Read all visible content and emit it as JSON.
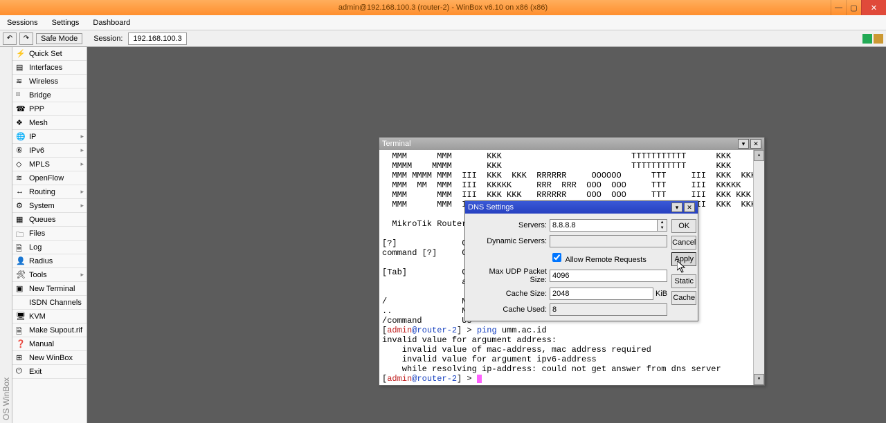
{
  "title": "admin@192.168.100.3 (router-2) - WinBox v6.10 on x86 (x86)",
  "menu": {
    "sessions": "Sessions",
    "settings": "Settings",
    "dashboard": "Dashboard"
  },
  "toolbar": {
    "back": "↶",
    "fwd": "↷",
    "safe_mode": "Safe Mode",
    "session_label": "Session:",
    "session_value": "192.168.100.3"
  },
  "sidebar_vert": "OS WinBox",
  "sidebar": [
    {
      "label": "Quick Set",
      "icon": "⚡",
      "arrow": false
    },
    {
      "label": "Interfaces",
      "icon": "▤",
      "arrow": false
    },
    {
      "label": "Wireless",
      "icon": "≋",
      "arrow": false
    },
    {
      "label": "Bridge",
      "icon": "⌗",
      "arrow": false
    },
    {
      "label": "PPP",
      "icon": "☎",
      "arrow": false
    },
    {
      "label": "Mesh",
      "icon": "❖",
      "arrow": false
    },
    {
      "label": "IP",
      "icon": "🌐",
      "arrow": true
    },
    {
      "label": "IPv6",
      "icon": "⑥",
      "arrow": true
    },
    {
      "label": "MPLS",
      "icon": "◇",
      "arrow": true
    },
    {
      "label": "OpenFlow",
      "icon": "≋",
      "arrow": false
    },
    {
      "label": "Routing",
      "icon": "↔",
      "arrow": true
    },
    {
      "label": "System",
      "icon": "⚙",
      "arrow": true
    },
    {
      "label": "Queues",
      "icon": "▦",
      "arrow": false
    },
    {
      "label": "Files",
      "icon": "🗀",
      "arrow": false
    },
    {
      "label": "Log",
      "icon": "🗎",
      "arrow": false
    },
    {
      "label": "Radius",
      "icon": "👤",
      "arrow": false
    },
    {
      "label": "Tools",
      "icon": "🛠",
      "arrow": true
    },
    {
      "label": "New Terminal",
      "icon": "▣",
      "arrow": false
    },
    {
      "label": "ISDN Channels",
      "icon": "",
      "arrow": false
    },
    {
      "label": "KVM",
      "icon": "🖥",
      "arrow": false
    },
    {
      "label": "Make Supout.rif",
      "icon": "🗎",
      "arrow": false
    },
    {
      "label": "Manual",
      "icon": "❓",
      "arrow": false
    },
    {
      "label": "New WinBox",
      "icon": "⊞",
      "arrow": false
    },
    {
      "label": "Exit",
      "icon": "⏻",
      "arrow": false
    }
  ],
  "terminal": {
    "title": "Terminal",
    "body": "  MMM      MMM       KKK                          TTTTTTTTTTT      KKK\n  MMMM    MMMM       KKK                          TTTTTTTTTTT      KKK\n  MMM MMMM MMM  III  KKK  KKK  RRRRRR     OOOOOO      TTT     III  KKK  KKK\n  MMM  MM  MMM  III  KKKKK     RRR  RRR  OOO  OOO     TTT     III  KKKKK\n  MMM      MMM  III  KKK KKK   RRRRRR    OOO  OOO     TTT     III  KKK KKK\n  MMM      MMM  III  KKK  KKK  RRR  RRR   OOOOOO      TTT     III  KKK  KKK\n\n  MikroTik RouterO\n\n[?]             Gi\ncommand [?]     Gi\n\n[Tab]           Co\n                a \n\n/               Mo\n..              Mo\n/command        Us",
    "prompt1_user": "admin",
    "prompt1_host": "@router-2",
    "prompt1_cmd": " > ",
    "prompt1_rest": "ping umm.ac.id",
    "err": "invalid value for argument address:\n    invalid value of mac-address, mac address required\n    invalid value for argument ipv6-address\n    while resolving ip-address: could not get answer from dns server",
    "prompt2_user": "admin",
    "prompt2_host": "@router-2",
    "prompt2_cmd": " > "
  },
  "dns": {
    "title": "DNS Settings",
    "servers_label": "Servers:",
    "servers_value": "8.8.8.8",
    "dynamic_label": "Dynamic Servers:",
    "dynamic_value": "",
    "allow_label": "Allow Remote Requests",
    "udp_label": "Max UDP Packet Size:",
    "udp_value": "4096",
    "cache_label": "Cache Size:",
    "cache_value": "2048",
    "cache_unit": "KiB",
    "used_label": "Cache Used:",
    "used_value": "8",
    "btn_ok": "OK",
    "btn_cancel": "Cancel",
    "btn_apply": "Apply",
    "btn_static": "Static",
    "btn_cache": "Cache"
  }
}
